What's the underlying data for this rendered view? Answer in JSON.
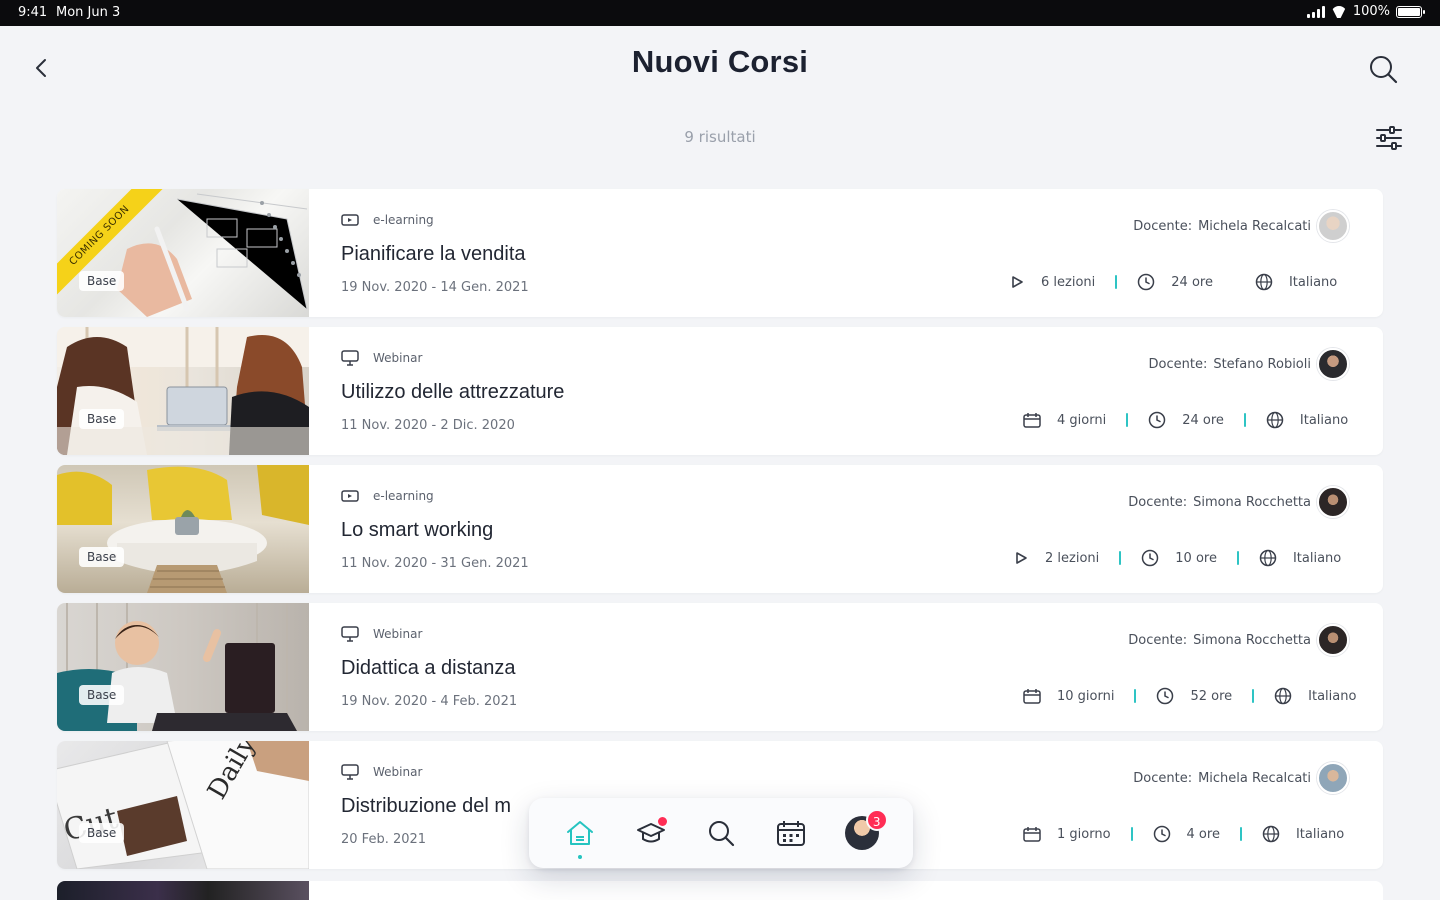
{
  "status_bar": {
    "time": "9:41",
    "date": "Mon Jun 3",
    "battery": "100%"
  },
  "header": {
    "title": "Nuovi Corsi",
    "results": "9 risultati"
  },
  "teacher_prefix": "Docente:",
  "courses": [
    {
      "ribbon": "COMING SOON",
      "level": "Base",
      "type": "e-learning",
      "title": "Pianificare la vendita",
      "dates": "19 Nov. 2020 - 14 Gen. 2021",
      "teacher": "Michela Recalcati",
      "meta": {
        "lessons": "6 lezioni",
        "hours": "24 ore",
        "language": "Italiano"
      }
    },
    {
      "level": "Base",
      "type": "Webinar",
      "title": "Utilizzo delle attrezzature",
      "dates": "11 Nov. 2020 - 2 Dic. 2020",
      "teacher": "Stefano Robioli",
      "meta": {
        "days": "4 giorni",
        "hours": "24 ore",
        "language": "Italiano"
      }
    },
    {
      "level": "Base",
      "type": "e-learning",
      "title": "Lo smart working",
      "dates": "11 Nov. 2020 - 31 Gen. 2021",
      "teacher": "Simona Rocchetta",
      "meta": {
        "lessons": "2 lezioni",
        "hours": "10 ore",
        "language": "Italiano"
      }
    },
    {
      "level": "Base",
      "type": "Webinar",
      "title": "Didattica a distanza",
      "dates": "19 Nov. 2020 - 4 Feb. 2021",
      "teacher": "Simona Rocchetta",
      "meta": {
        "days": "10 giorni",
        "hours": "52 ore",
        "language": "Italiano"
      }
    },
    {
      "level": "Base",
      "type": "Webinar",
      "title": "Distribuzione del m",
      "dates": "20 Feb. 2021",
      "teacher": "Michela Recalcati",
      "meta": {
        "days": "1 giorno",
        "hours": "4 ore",
        "language": "Italiano"
      }
    }
  ],
  "bottom_nav": {
    "items": [
      "home-icon",
      "courses-icon",
      "search-icon",
      "calendar-icon",
      "profile-avatar"
    ],
    "active": "home-icon",
    "notifications": "3"
  },
  "colors": {
    "accent": "#25c4c0",
    "badge": "#ff2d55",
    "ribbon": "#f5d219"
  }
}
